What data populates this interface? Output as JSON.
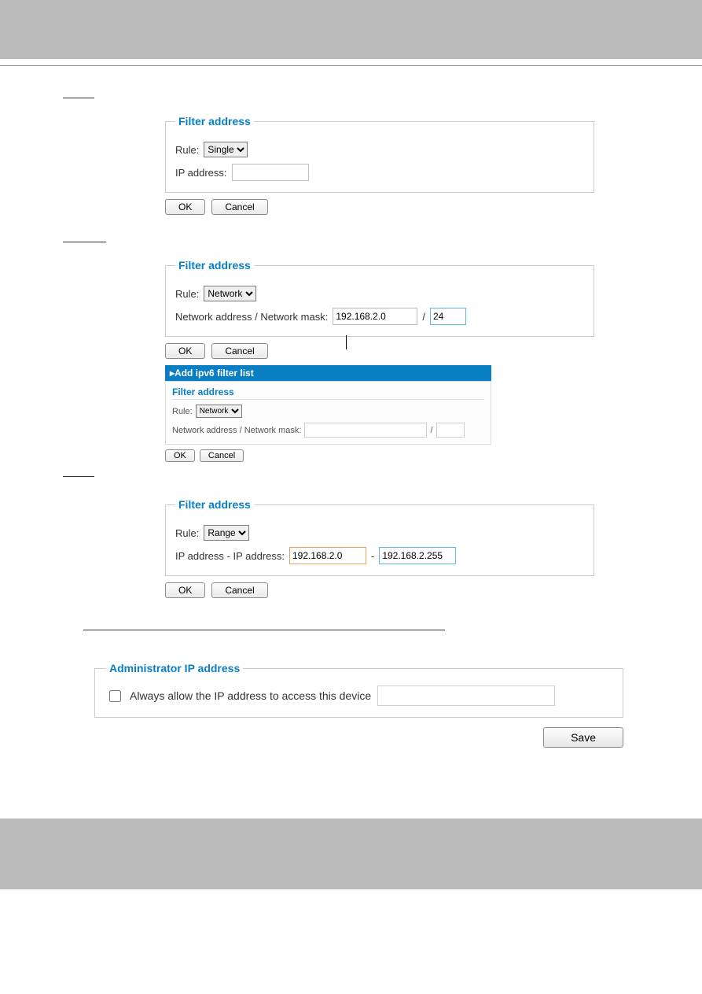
{
  "filter": {
    "legend": "Filter address",
    "rule_label": "Rule:",
    "ip_label": "IP address:",
    "net_label": "Network address / Network mask:",
    "range_label": "IP address - IP address:",
    "slash": "/",
    "dash": "-",
    "ok": "OK",
    "cancel": "Cancel"
  },
  "single": {
    "rule_option": "Single",
    "ip_value": ""
  },
  "network": {
    "rule_option": "Network",
    "addr_value": "192.168.2.0",
    "mask_value": "24"
  },
  "ipv6": {
    "title": "▸Add ipv6 filter list",
    "legend": "Filter address",
    "rule_label": "Rule:",
    "rule_option": "Network",
    "net_label": "Network address / Network mask:",
    "addr_value": "",
    "mask_value": "",
    "ok": "OK",
    "cancel": "Cancel"
  },
  "range": {
    "rule_option": "Range",
    "from_value": "192.168.2.0",
    "to_value": "192.168.2.255"
  },
  "admin": {
    "legend": "Administrator IP address",
    "checkbox_label": "Always allow the IP address to access this device",
    "ip_value": "",
    "save": "Save"
  }
}
